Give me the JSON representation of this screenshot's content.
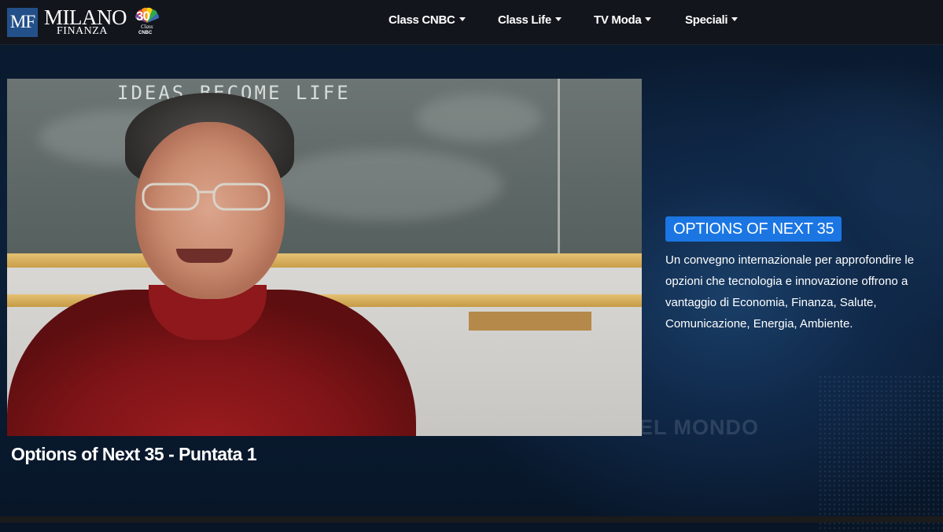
{
  "brand": {
    "mf": "MF",
    "milano": "MILANO",
    "finanza": "FINANZA",
    "anniversary": "30",
    "class_label": "Class",
    "cnbc_label": "CNBC"
  },
  "nav": {
    "items": [
      {
        "label": "Class CNBC"
      },
      {
        "label": "Class Life"
      },
      {
        "label": "TV Moda"
      },
      {
        "label": "Speciali"
      }
    ]
  },
  "video": {
    "title": "Options of Next 35 - Puntata 1",
    "chalkboard_text": "IDEAS BECOME LIFE"
  },
  "feature": {
    "badge": "OPTIONS OF NEXT 35",
    "description_lines": [
      "Un convegno internazionale per approfondire le",
      "opzioni che tecnologia e innovazione offrono a",
      "vantaggio di Economia, Finanza, Salute,",
      "Comunicazione, Energia, Ambiente."
    ]
  },
  "background": {
    "watermark": "EL MONDO"
  },
  "colors": {
    "navbar": "#12161c",
    "badge": "#1b76e3",
    "logo_box": "#24508a",
    "background": "#081526"
  }
}
